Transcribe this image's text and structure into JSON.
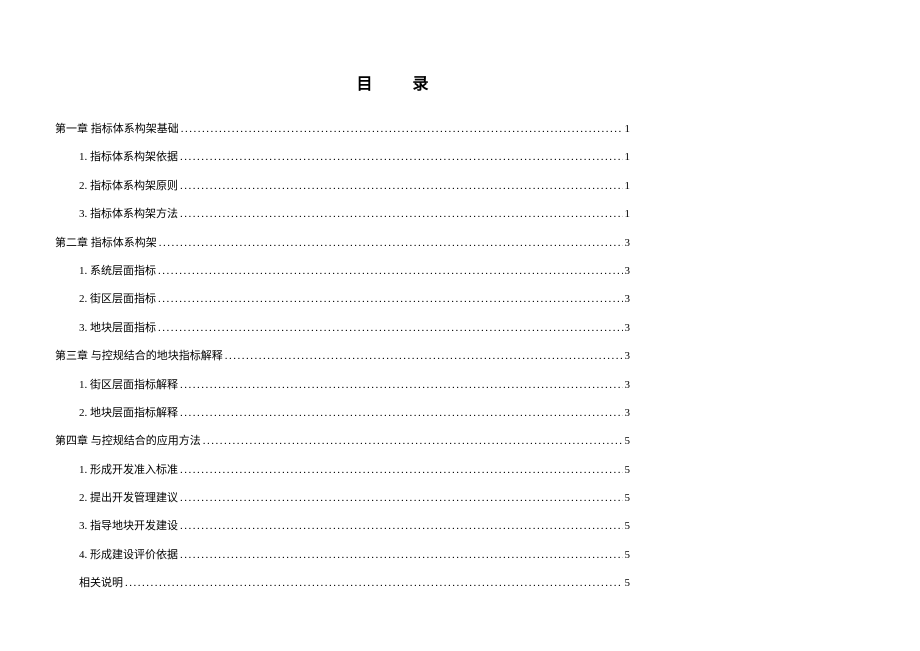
{
  "title": "目录",
  "entries": [
    {
      "level": 1,
      "label": "第一章  指标体系构架基础",
      "page": "1"
    },
    {
      "level": 2,
      "label": "1.  指标体系构架依据",
      "page": "1"
    },
    {
      "level": 2,
      "label": "2.  指标体系构架原则",
      "page": "1"
    },
    {
      "level": 2,
      "label": "3.  指标体系构架方法",
      "page": "1"
    },
    {
      "level": 1,
      "label": "第二章  指标体系构架",
      "page": "3"
    },
    {
      "level": 2,
      "label": "1.  系统层面指标",
      "page": "3"
    },
    {
      "level": 2,
      "label": "2.  街区层面指标",
      "page": "3"
    },
    {
      "level": 2,
      "label": "3.  地块层面指标",
      "page": "3"
    },
    {
      "level": 1,
      "label": "第三章  与控规结合的地块指标解释",
      "page": "3"
    },
    {
      "level": 2,
      "label": "1.  街区层面指标解释",
      "page": "3"
    },
    {
      "level": 2,
      "label": "2.  地块层面指标解释",
      "page": "3"
    },
    {
      "level": 1,
      "label": "第四章  与控规结合的应用方法",
      "page": "5"
    },
    {
      "level": 2,
      "label": "1. 形成开发准入标准",
      "page": "5"
    },
    {
      "level": 2,
      "label": "2. 提出开发管理建议",
      "page": "5"
    },
    {
      "level": 2,
      "label": "3. 指导地块开发建设",
      "page": "5"
    },
    {
      "level": 2,
      "label": "4. 形成建设评价依据",
      "page": "5"
    },
    {
      "level": 2,
      "label": "相关说明",
      "page": "5"
    }
  ]
}
